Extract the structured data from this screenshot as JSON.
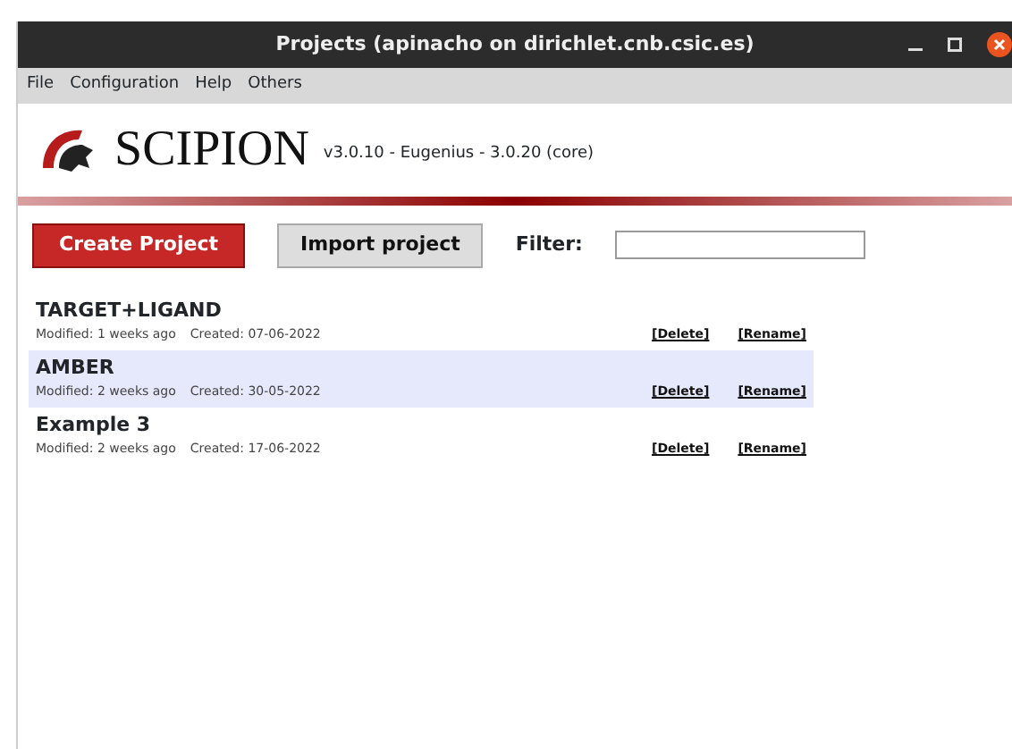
{
  "window": {
    "title": "Projects (apinacho on dirichlet.cnb.csic.es)"
  },
  "menu": [
    "File",
    "Configuration",
    "Help",
    "Others"
  ],
  "header": {
    "logo_text": "SCIPION",
    "version": "v3.0.10 - Eugenius - 3.0.20 (core)"
  },
  "toolbar": {
    "create_button": "Create Project",
    "import_button": "Import project",
    "filter_label": "Filter:"
  },
  "projects": [
    {
      "name": "TARGET+LIGAND",
      "modified": "Modified: 1 weeks ago",
      "created": "Created: 07-06-2022",
      "delete": "[Delete]",
      "rename": "[Rename]",
      "selected": false
    },
    {
      "name": "AMBER",
      "modified": "Modified: 2 weeks ago",
      "created": "Created: 30-05-2022",
      "delete": "[Delete]",
      "rename": "[Rename]",
      "selected": true
    },
    {
      "name": "Example 3",
      "modified": "Modified: 2 weeks ago",
      "created": "Created: 17-06-2022",
      "delete": "[Delete]",
      "rename": "[Rename]",
      "selected": false
    }
  ]
}
